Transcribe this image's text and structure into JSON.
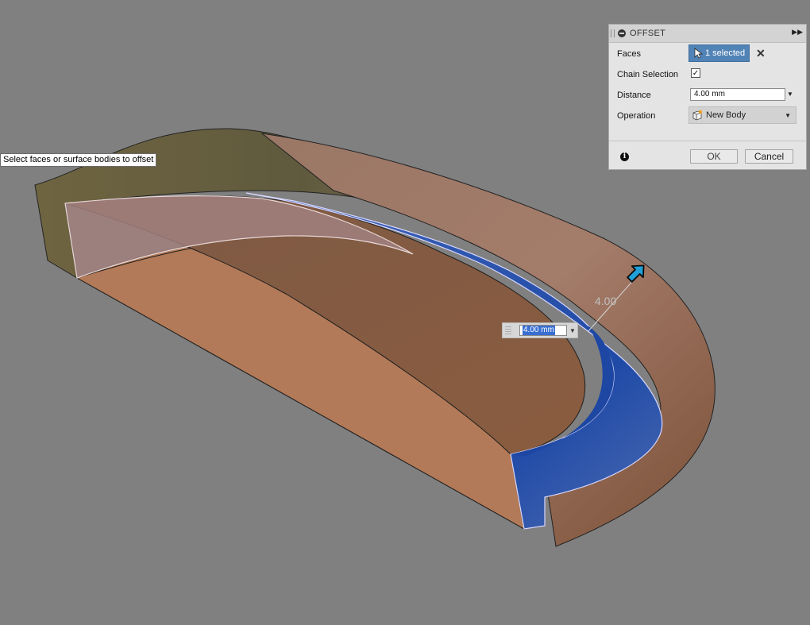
{
  "tooltip": {
    "text": "Select faces or surface bodies to offset"
  },
  "viewport": {
    "dimension_label": "4.00",
    "inline_input_value": "4.00 mm"
  },
  "panel": {
    "title": "OFFSET",
    "faces": {
      "label": "Faces",
      "selection": "1 selected"
    },
    "chain_selection": {
      "label": "Chain Selection",
      "checked": true,
      "mark": "✓"
    },
    "distance": {
      "label": "Distance",
      "value": "4.00 mm"
    },
    "operation": {
      "label": "Operation",
      "value": "New Body"
    },
    "buttons": {
      "ok": "OK",
      "cancel": "Cancel"
    }
  },
  "colors": {
    "background": "#808080",
    "selected_face": "#3b63b5",
    "body_copper": "#b17a58",
    "surface_olive": "#6c6240",
    "panel_accent": "#5183b6"
  }
}
